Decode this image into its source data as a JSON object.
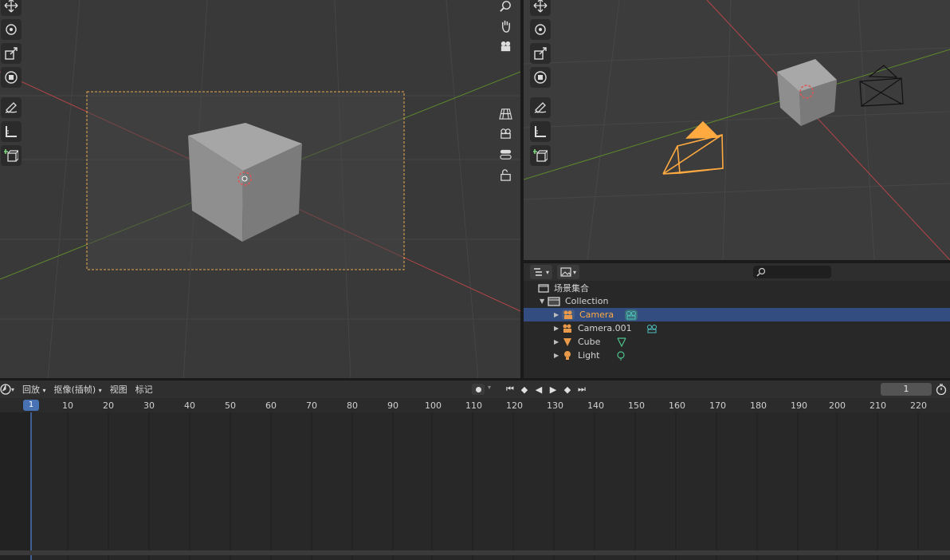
{
  "outliner": {
    "root": "场景集合",
    "collection": "Collection",
    "items": [
      {
        "label": "Camera",
        "icon": "camera-icon",
        "data_icon": "camera-data-icon",
        "selected": true
      },
      {
        "label": "Camera.001",
        "icon": "camera-icon",
        "data_icon": "camera-data-icon",
        "selected": false
      },
      {
        "label": "Cube",
        "icon": "mesh-icon",
        "data_icon": "vertex-group-icon",
        "selected": false
      },
      {
        "label": "Light",
        "icon": "light-icon",
        "data_icon": "light-data-icon",
        "selected": false
      }
    ]
  },
  "timeline": {
    "menus": [
      "回放",
      "抠像(插帧)",
      "视图",
      "标记"
    ],
    "current_frame": "1",
    "frame_field": "1",
    "ticks": [
      "10",
      "20",
      "30",
      "40",
      "50",
      "60",
      "70",
      "80",
      "90",
      "100",
      "110",
      "120",
      "130",
      "140",
      "150",
      "160",
      "170",
      "180",
      "190",
      "200",
      "210",
      "220"
    ]
  },
  "colors": {
    "selection": "#334d80",
    "accent": "#4772b3",
    "selected_object": "#ffaa40",
    "x_axis": "#c8474a",
    "y_axis": "#6c9a31"
  }
}
